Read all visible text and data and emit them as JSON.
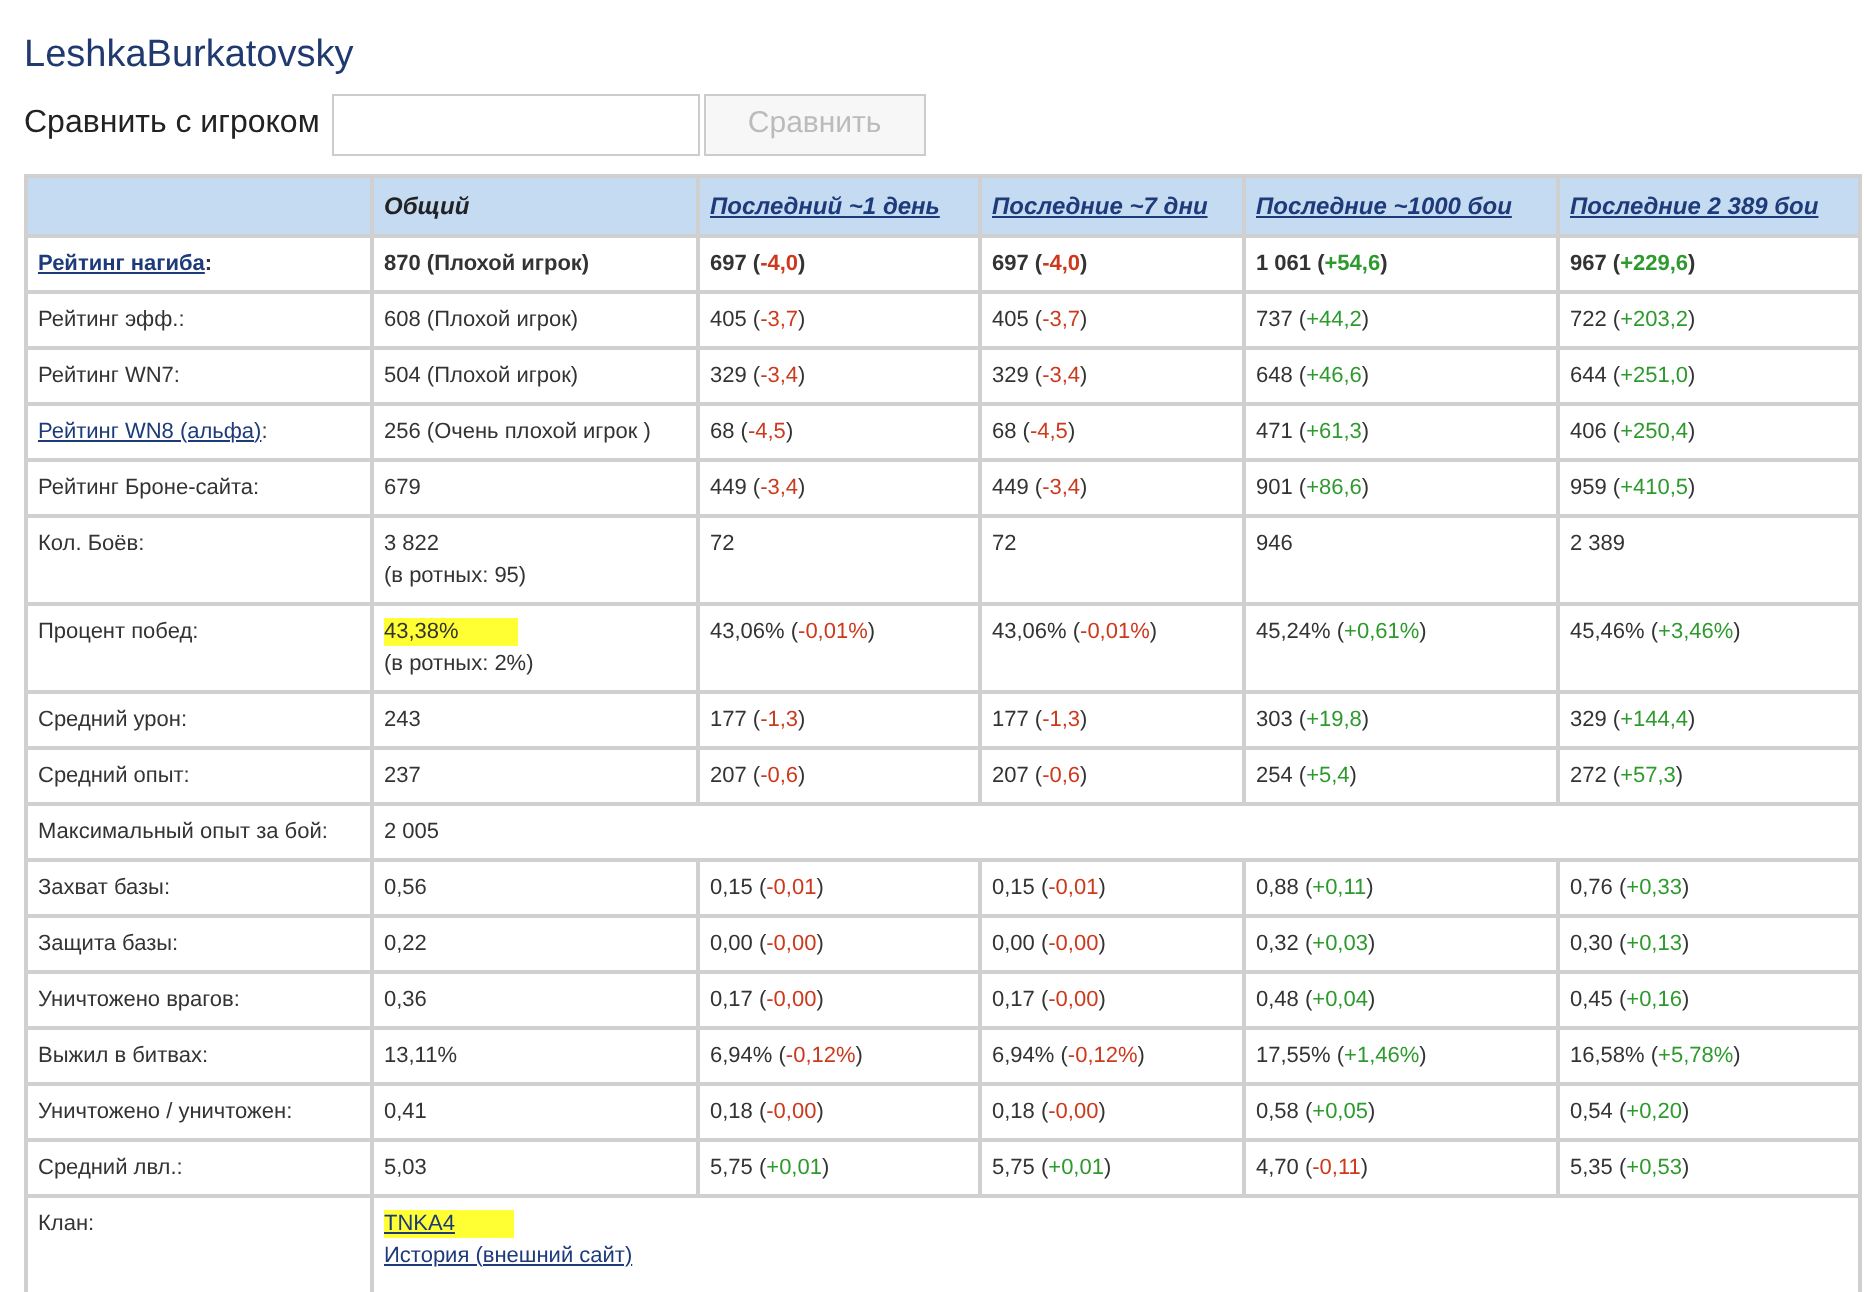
{
  "player": {
    "name": "LeshkaBurkatovsky"
  },
  "compare": {
    "label": "Сравнить с игроком",
    "button": "Сравнить",
    "button_disabled": true
  },
  "table": {
    "columns": [
      {
        "label": "Общий",
        "link": false
      },
      {
        "label": "Последний ~1 день",
        "link": true
      },
      {
        "label": "Последние ~7 дни",
        "link": true
      },
      {
        "label": "Последние ~1000 бои",
        "link": true
      },
      {
        "label": "Последние 2 389 бои",
        "link": true
      }
    ],
    "rows": [
      {
        "kind": "stat",
        "label_link": "Рейтинг нагиба",
        "label": ":",
        "bold": true,
        "overall": {
          "value": "870 (Плохой игрок)",
          "highlighted": false
        },
        "periods": [
          {
            "value": "697 (",
            "delta": "-4,0",
            "close": ")",
            "color": "#cc3a1e"
          },
          {
            "value": "697 (",
            "delta": "-4,0",
            "close": ")",
            "color": "#cc3a1e"
          },
          {
            "value": "1 061 (",
            "delta": "+54,6",
            "close": ")",
            "color": "#2e9a2e"
          },
          {
            "value": "967 (",
            "delta": "+229,6",
            "close": ")",
            "color": "#2e9a2e"
          }
        ]
      },
      {
        "kind": "stat",
        "label": "Рейтинг эфф.:",
        "bold": false,
        "overall": {
          "value": "608 (Плохой игрок)",
          "highlighted": false
        },
        "periods": [
          {
            "value": "405 (",
            "delta": "-3,7",
            "close": ")",
            "color": "#cc3a1e"
          },
          {
            "value": "405 (",
            "delta": "-3,7",
            "close": ")",
            "color": "#cc3a1e"
          },
          {
            "value": "737 (",
            "delta": "+44,2",
            "close": ")",
            "color": "#2e9a2e"
          },
          {
            "value": "722 (",
            "delta": "+203,2",
            "close": ")",
            "color": "#2e9a2e"
          }
        ]
      },
      {
        "kind": "stat",
        "label": "Рейтинг WN7:",
        "bold": false,
        "overall": {
          "value": "504 (Плохой игрок)",
          "highlighted": false
        },
        "periods": [
          {
            "value": "329 (",
            "delta": "-3,4",
            "close": ")",
            "color": "#cc3a1e"
          },
          {
            "value": "329 (",
            "delta": "-3,4",
            "close": ")",
            "color": "#cc3a1e"
          },
          {
            "value": "648 (",
            "delta": "+46,6",
            "close": ")",
            "color": "#2e9a2e"
          },
          {
            "value": "644 (",
            "delta": "+251,0",
            "close": ")",
            "color": "#2e9a2e"
          }
        ]
      },
      {
        "kind": "stat",
        "label_link": "Рейтинг WN8 (альфа)",
        "label": ":",
        "bold": false,
        "overall": {
          "value": "256 (Очень плохой игрок )",
          "highlighted": false
        },
        "periods": [
          {
            "value": "68 (",
            "delta": "-4,5",
            "close": ")",
            "color": "#cc3a1e"
          },
          {
            "value": "68 (",
            "delta": "-4,5",
            "close": ")",
            "color": "#cc3a1e"
          },
          {
            "value": "471 (",
            "delta": "+61,3",
            "close": ")",
            "color": "#2e9a2e"
          },
          {
            "value": "406 (",
            "delta": "+250,4",
            "close": ")",
            "color": "#2e9a2e"
          }
        ]
      },
      {
        "kind": "stat",
        "label": "Рейтинг Броне-сайта:",
        "bold": false,
        "overall": {
          "value": "679",
          "highlighted": false
        },
        "periods": [
          {
            "value": "449 (",
            "delta": "-3,4",
            "close": ")",
            "color": "#cc3a1e"
          },
          {
            "value": "449 (",
            "delta": "-3,4",
            "close": ")",
            "color": "#cc3a1e"
          },
          {
            "value": "901 (",
            "delta": "+86,6",
            "close": ")",
            "color": "#2e9a2e"
          },
          {
            "value": "959 (",
            "delta": "+410,5",
            "close": ")",
            "color": "#2e9a2e"
          }
        ]
      },
      {
        "kind": "stat",
        "label": "Кол. Боёв:",
        "bold": false,
        "overall": {
          "value": "3 822",
          "note": "(в ротных: 95)",
          "highlighted": false
        },
        "periods": [
          {
            "value": "72"
          },
          {
            "value": "72"
          },
          {
            "value": "946"
          },
          {
            "value": "2 389"
          }
        ]
      },
      {
        "kind": "stat",
        "label": "Процент побед:",
        "bold": false,
        "overall": {
          "value": "43,38%",
          "note": "(в ротных: 2%)",
          "highlighted": true
        },
        "periods": [
          {
            "value": "43,06% (",
            "delta": "-0,01%",
            "close": ")",
            "color": "#cc3a1e"
          },
          {
            "value": "43,06% (",
            "delta": "-0,01%",
            "close": ")",
            "color": "#cc3a1e"
          },
          {
            "value": "45,24% (",
            "delta": "+0,61%",
            "close": ")",
            "color": "#2e9a2e"
          },
          {
            "value": "45,46% (",
            "delta": "+3,46%",
            "close": ")",
            "color": "#2e9a2e"
          }
        ]
      },
      {
        "kind": "stat",
        "label": "Средний урон:",
        "bold": false,
        "overall": {
          "value": "243",
          "highlighted": false
        },
        "periods": [
          {
            "value": "177 (",
            "delta": "-1,3",
            "close": ")",
            "color": "#cc3a1e"
          },
          {
            "value": "177 (",
            "delta": "-1,3",
            "close": ")",
            "color": "#cc3a1e"
          },
          {
            "value": "303 (",
            "delta": "+19,8",
            "close": ")",
            "color": "#2e9a2e"
          },
          {
            "value": "329 (",
            "delta": "+144,4",
            "close": ")",
            "color": "#2e9a2e"
          }
        ]
      },
      {
        "kind": "stat",
        "label": "Средний опыт:",
        "bold": false,
        "overall": {
          "value": "237",
          "highlighted": false
        },
        "periods": [
          {
            "value": "207 (",
            "delta": "-0,6",
            "close": ")",
            "color": "#cc3a1e"
          },
          {
            "value": "207 (",
            "delta": "-0,6",
            "close": ")",
            "color": "#cc3a1e"
          },
          {
            "value": "254 (",
            "delta": "+5,4",
            "close": ")",
            "color": "#2e9a2e"
          },
          {
            "value": "272 (",
            "delta": "+57,3",
            "close": ")",
            "color": "#2e9a2e"
          }
        ]
      },
      {
        "kind": "single",
        "label": "Максимальный опыт за бой:",
        "value": "2 005"
      },
      {
        "kind": "stat",
        "label": "Захват базы:",
        "bold": false,
        "overall": {
          "value": "0,56",
          "highlighted": false
        },
        "periods": [
          {
            "value": "0,15 (",
            "delta": "-0,01",
            "close": ")",
            "color": "#cc3a1e"
          },
          {
            "value": "0,15 (",
            "delta": "-0,01",
            "close": ")",
            "color": "#cc3a1e"
          },
          {
            "value": "0,88 (",
            "delta": "+0,11",
            "close": ")",
            "color": "#2e9a2e"
          },
          {
            "value": "0,76 (",
            "delta": "+0,33",
            "close": ")",
            "color": "#2e9a2e"
          }
        ]
      },
      {
        "kind": "stat",
        "label": "Защита базы:",
        "bold": false,
        "overall": {
          "value": "0,22",
          "highlighted": false
        },
        "periods": [
          {
            "value": "0,00 (",
            "delta": "-0,00",
            "close": ")",
            "color": "#cc3a1e"
          },
          {
            "value": "0,00 (",
            "delta": "-0,00",
            "close": ")",
            "color": "#cc3a1e"
          },
          {
            "value": "0,32 (",
            "delta": "+0,03",
            "close": ")",
            "color": "#2e9a2e"
          },
          {
            "value": "0,30 (",
            "delta": "+0,13",
            "close": ")",
            "color": "#2e9a2e"
          }
        ]
      },
      {
        "kind": "stat",
        "label": "Уничтожено врагов:",
        "bold": false,
        "overall": {
          "value": "0,36",
          "highlighted": false
        },
        "periods": [
          {
            "value": "0,17 (",
            "delta": "-0,00",
            "close": ")",
            "color": "#cc3a1e"
          },
          {
            "value": "0,17 (",
            "delta": "-0,00",
            "close": ")",
            "color": "#cc3a1e"
          },
          {
            "value": "0,48 (",
            "delta": "+0,04",
            "close": ")",
            "color": "#2e9a2e"
          },
          {
            "value": "0,45 (",
            "delta": "+0,16",
            "close": ")",
            "color": "#2e9a2e"
          }
        ]
      },
      {
        "kind": "stat",
        "label": "Выжил в битвах:",
        "bold": false,
        "overall": {
          "value": "13,11%",
          "highlighted": false
        },
        "periods": [
          {
            "value": "6,94% (",
            "delta": "-0,12%",
            "close": ")",
            "color": "#cc3a1e"
          },
          {
            "value": "6,94% (",
            "delta": "-0,12%",
            "close": ")",
            "color": "#cc3a1e"
          },
          {
            "value": "17,55% (",
            "delta": "+1,46%",
            "close": ")",
            "color": "#2e9a2e"
          },
          {
            "value": "16,58% (",
            "delta": "+5,78%",
            "close": ")",
            "color": "#2e9a2e"
          }
        ]
      },
      {
        "kind": "stat",
        "label": "Уничтожено / уничтожен:",
        "bold": false,
        "overall": {
          "value": "0,41",
          "highlighted": false
        },
        "periods": [
          {
            "value": "0,18 (",
            "delta": "-0,00",
            "close": ")",
            "color": "#cc3a1e"
          },
          {
            "value": "0,18 (",
            "delta": "-0,00",
            "close": ")",
            "color": "#cc3a1e"
          },
          {
            "value": "0,58 (",
            "delta": "+0,05",
            "close": ")",
            "color": "#2e9a2e"
          },
          {
            "value": "0,54 (",
            "delta": "+0,20",
            "close": ")",
            "color": "#2e9a2e"
          }
        ]
      },
      {
        "kind": "stat",
        "label": "Средний лвл.:",
        "bold": false,
        "overall": {
          "value": "5,03",
          "highlighted": false
        },
        "periods": [
          {
            "value": "5,75 (",
            "delta": "+0,01",
            "close": ")",
            "color": "#2e9a2e"
          },
          {
            "value": "5,75 (",
            "delta": "+0,01",
            "close": ")",
            "color": "#2e9a2e"
          },
          {
            "value": "4,70 (",
            "delta": "-0,11",
            "close": ")",
            "color": "#cc3a1e"
          },
          {
            "value": "5,35 (",
            "delta": "+0,53",
            "close": ")",
            "color": "#2e9a2e"
          }
        ]
      },
      {
        "kind": "clan",
        "label": "Клан:",
        "clan": "TNKA4",
        "clan_highlighted": true,
        "history": "История (внешний сайт)"
      }
    ]
  }
}
